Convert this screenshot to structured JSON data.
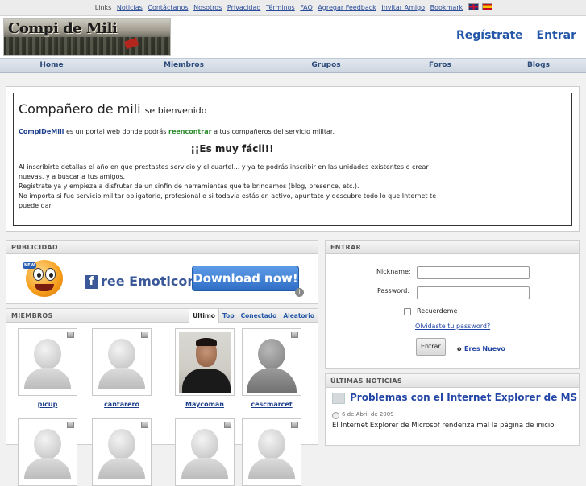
{
  "topbar": {
    "links": [
      "Links",
      "Noticias",
      "Contáctanos",
      "Nosotros",
      "Privacidad",
      "Términos",
      "FAQ",
      "Agregar Feedback",
      "Invitar Amigo",
      "Bookmark"
    ],
    "flags": [
      "uk-flag-icon",
      "es-flag-icon"
    ]
  },
  "header": {
    "logo_text": "Compi de Mili",
    "register": "Regístrate",
    "login": "Entrar"
  },
  "nav": [
    "Home",
    "Miembros",
    "Grupos",
    "Foros",
    "Blogs"
  ],
  "welcome": {
    "title": "Compañero de mili",
    "subtitle": "se bienvenido",
    "brand": "CompiDeMili",
    "p1_a": " es un portal web donde podrás ",
    "p1_green": "reencontrar",
    "p1_b": " a tus compañeros del servicio militar.",
    "easy": "¡¡Es muy fácil!!",
    "l1": "Al inscribirte detallas el año en que prestastes servicio y el cuartel... y ya te podrás inscribir en las unidades existentes o crear",
    "l2": "nuevas, y a buscar a tus amigos.",
    "l3": "Registrate ya y empieza a disfrutar de un sinfin de herramientas que te brindamos (blog, presence, etc.).",
    "l4": "No importa si fue servicio militar obligatorio, profesional o si todavía estás en activo, apuntate y descubre todo lo que Internet te",
    "l5": "puede dar."
  },
  "ad": {
    "heading": "PUBLICIDAD",
    "badge": "NEW",
    "f": "f",
    "text": "ree Emoticons",
    "button": "Download now!",
    "info": "i"
  },
  "members": {
    "heading": "MIEMBROS",
    "tabs": [
      "Ultimo",
      "Top",
      "Conectado",
      "Aleatorio"
    ],
    "names": [
      "picup",
      "cantarero",
      "Maycoman",
      "cescmarcet"
    ]
  },
  "login": {
    "heading": "ENTRAR",
    "nickname_label": "Nickname:",
    "password_label": "Password:",
    "remember": "Recuerdeme",
    "forgot": "Olvidaste tu password?",
    "submit": "Entrar",
    "or": "o",
    "new": "Eres Nuevo"
  },
  "news": {
    "heading": "ÚLTIMAS NOTICIAS",
    "title": "Problemas con el Internet Explorer de MS",
    "date": "6 de Abril de 2009",
    "text": "El Internet Explorer de Microsof renderiza mal la página de inicio."
  },
  "colors": {
    "link": "#1d3f8c",
    "header_link": "#2457a8",
    "ad_button": "#2f6ec5"
  }
}
